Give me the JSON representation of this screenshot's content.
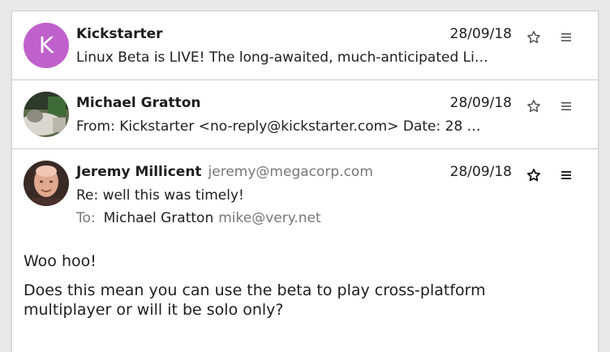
{
  "messages": [
    {
      "avatar_letter": "K",
      "avatar_color": "#c061cb",
      "sender": "Kickstarter",
      "date": "28/09/18",
      "snippet": "Linux Beta is LIVE! The long-awaited, much-anticipated Li…",
      "star_icon": "star-outline-icon",
      "menu_icon": "hamburger-menu-icon"
    },
    {
      "avatar": "photo",
      "sender": "Michael Gratton",
      "date": "28/09/18",
      "snippet": "From: Kickstarter <no-reply@kickstarter.com> Date: 28 …",
      "star_icon": "star-outline-icon",
      "menu_icon": "hamburger-menu-icon"
    },
    {
      "avatar": "photo",
      "sender": "Jeremy Millicent",
      "sender_email": "jeremy@megacorp.com",
      "date": "28/09/18",
      "subject": "Re: well this was timely!",
      "to_label": "To:",
      "to_name": "Michael Gratton",
      "to_email": "mike@very.net",
      "body_lines": [
        "Woo hoo!",
        "Does this mean you can use the beta to play cross-platform multiplayer or will it be solo only?"
      ],
      "star_icon": "star-outline-icon",
      "menu_icon": "hamburger-menu-icon"
    }
  ]
}
